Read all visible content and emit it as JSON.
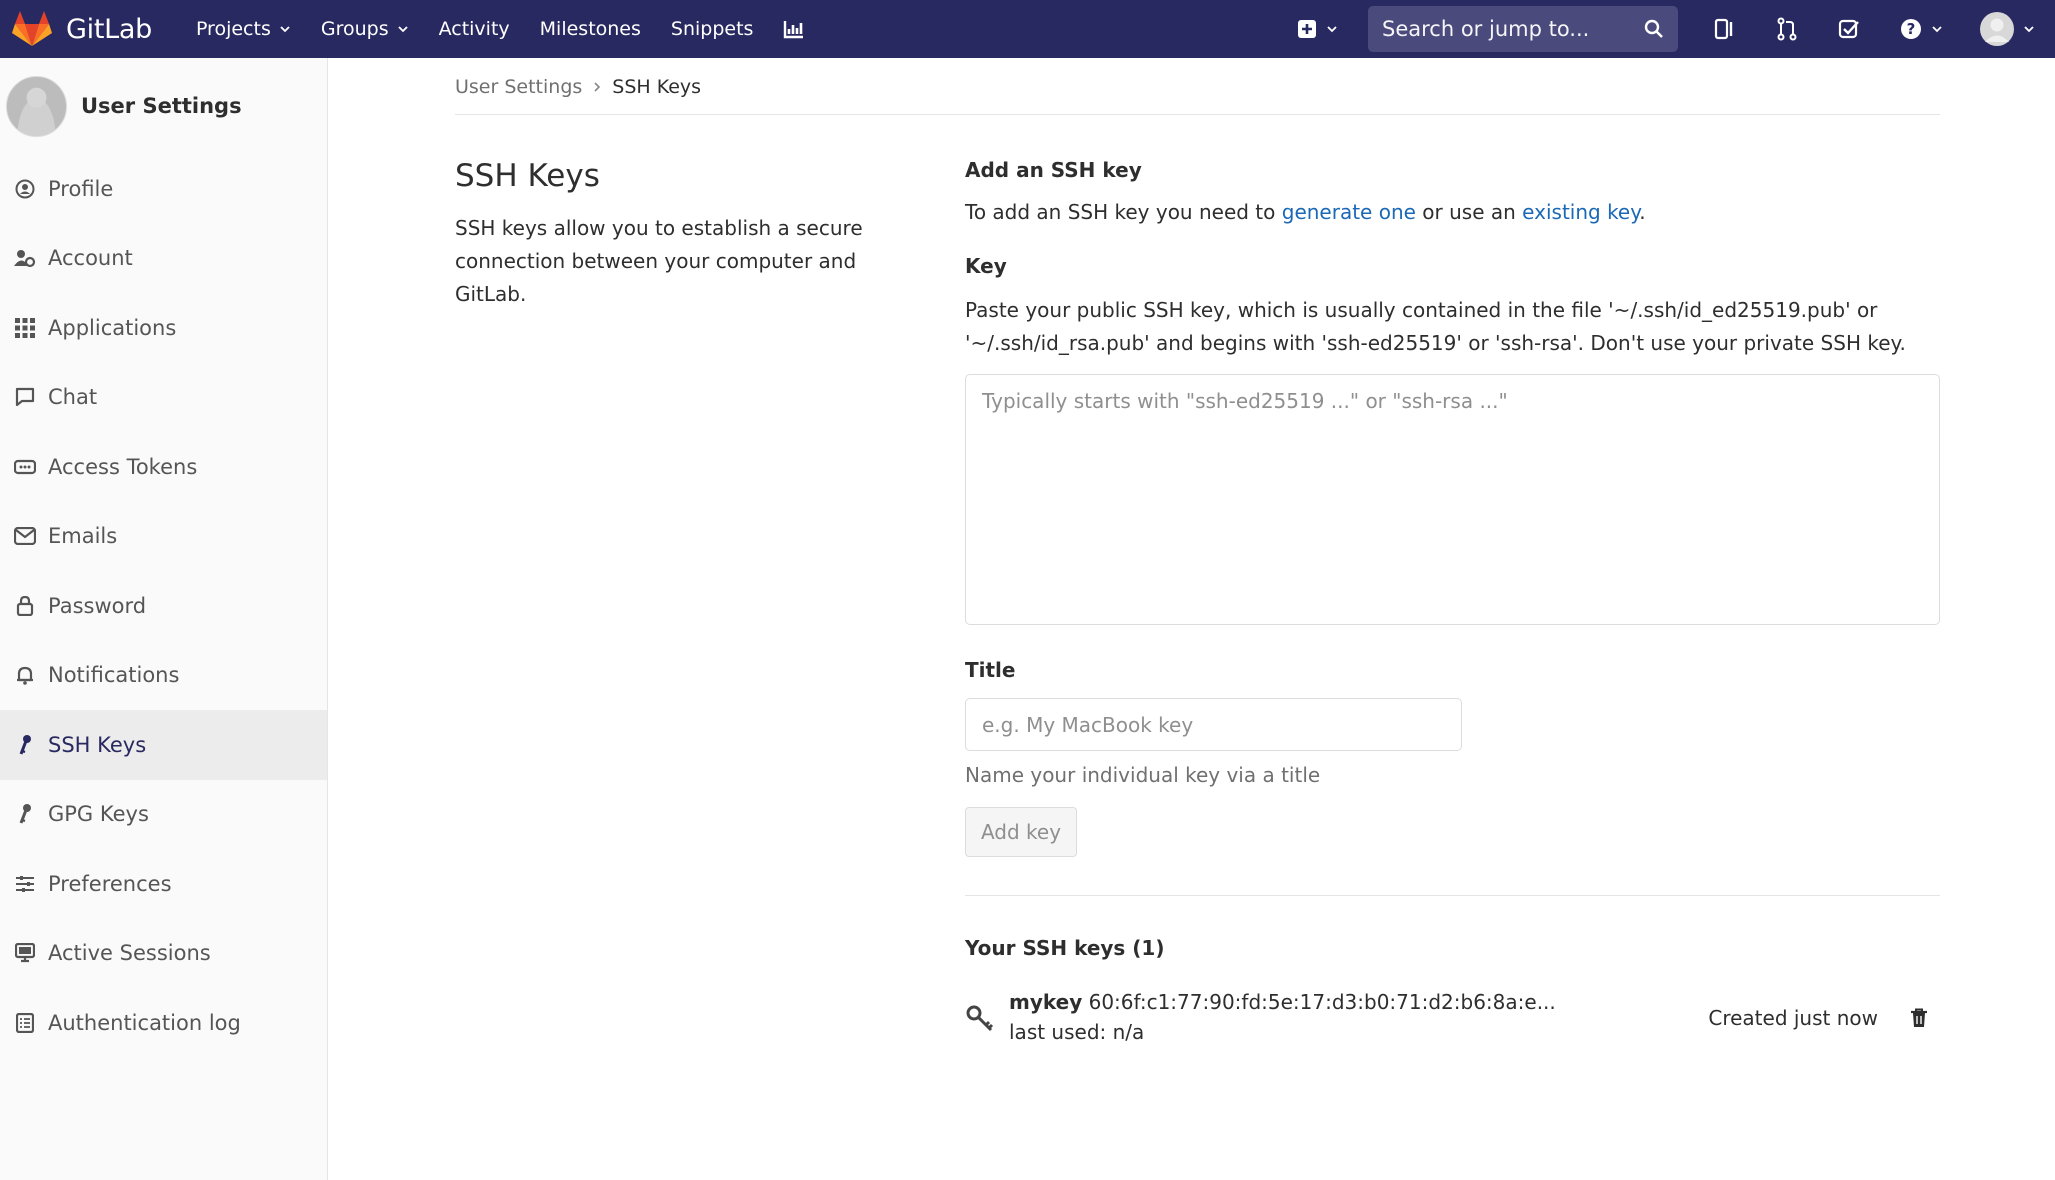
{
  "navbar": {
    "brand": "GitLab",
    "links": [
      {
        "label": "Projects",
        "dropdown": true
      },
      {
        "label": "Groups",
        "dropdown": true
      },
      {
        "label": "Activity",
        "dropdown": false
      },
      {
        "label": "Milestones",
        "dropdown": false
      },
      {
        "label": "Snippets",
        "dropdown": false
      }
    ],
    "search_placeholder": "Search or jump to...",
    "icons": [
      "plus-square-icon",
      "search-icon",
      "sidebar-panel-icon",
      "merge-request-icon",
      "todo-check-icon",
      "help-icon",
      "user-avatar-icon"
    ]
  },
  "sidebar": {
    "title": "User Settings",
    "items": [
      {
        "label": "Profile",
        "icon": "profile-icon",
        "active": false
      },
      {
        "label": "Account",
        "icon": "account-gear-icon",
        "active": false
      },
      {
        "label": "Applications",
        "icon": "applications-grid-icon",
        "active": false
      },
      {
        "label": "Chat",
        "icon": "chat-icon",
        "active": false
      },
      {
        "label": "Access Tokens",
        "icon": "token-icon",
        "active": false
      },
      {
        "label": "Emails",
        "icon": "email-icon",
        "active": false
      },
      {
        "label": "Password",
        "icon": "lock-icon",
        "active": false
      },
      {
        "label": "Notifications",
        "icon": "bell-icon",
        "active": false
      },
      {
        "label": "SSH Keys",
        "icon": "key-icon",
        "active": true
      },
      {
        "label": "GPG Keys",
        "icon": "key-icon",
        "active": false
      },
      {
        "label": "Preferences",
        "icon": "sliders-icon",
        "active": false
      },
      {
        "label": "Active Sessions",
        "icon": "monitor-icon",
        "active": false
      },
      {
        "label": "Authentication log",
        "icon": "list-log-icon",
        "active": false
      }
    ]
  },
  "breadcrumb": {
    "parent": "User Settings",
    "current": "SSH Keys"
  },
  "intro": {
    "title": "SSH Keys",
    "description": "SSH keys allow you to establish a secure connection between your computer and GitLab."
  },
  "add_section": {
    "heading": "Add an SSH key",
    "desc_prefix": "To add an SSH key you need to ",
    "link_generate": "generate one",
    "desc_middle": " or use an ",
    "link_existing": "existing key",
    "desc_suffix": "."
  },
  "key_field": {
    "label": "Key",
    "description": "Paste your public SSH key, which is usually contained in the file '~/.ssh/id_ed25519.pub' or '~/.ssh/id_rsa.pub' and begins with 'ssh-ed25519' or 'ssh-rsa'. Don't use your private SSH key.",
    "placeholder": "Typically starts with \"ssh-ed25519 ...\" or \"ssh-rsa ...\"",
    "value": ""
  },
  "title_field": {
    "label": "Title",
    "placeholder": "e.g. My MacBook key",
    "value": "",
    "help": "Name your individual key via a title"
  },
  "add_button": "Add key",
  "keys_list": {
    "heading": "Your SSH keys (1)",
    "keys": [
      {
        "name": "mykey",
        "fingerprint": "60:6f:c1:77:90:fd:5e:17:d3:b0:71:d2:b6:8a:e...",
        "last_used": "last used: n/a",
        "created": "Created just now"
      }
    ]
  }
}
